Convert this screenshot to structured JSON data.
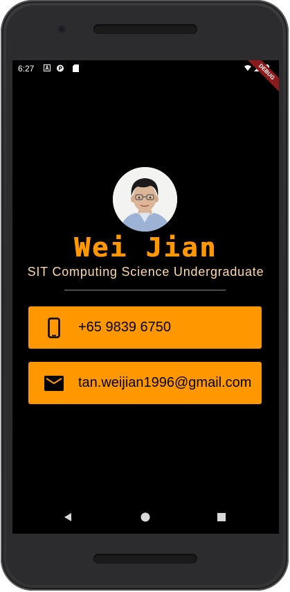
{
  "status_bar": {
    "time": "6:27",
    "icons": [
      "a-notification-icon",
      "p-notification-icon",
      "sd-card-icon",
      "wifi-icon",
      "cell-signal-icon",
      "battery-icon"
    ]
  },
  "debug_banner": "DEBUG",
  "profile": {
    "name": "Wei Jian",
    "title": "SIT Computing Science Undergraduate"
  },
  "contacts": {
    "phone": "+65 9839 6750",
    "email": "tan.weijian1996@gmail.com"
  },
  "colors": {
    "accent": "#FF9800",
    "background": "#000000",
    "subtitle": "#FFD9A6"
  },
  "nav": {
    "icons": [
      "back-icon",
      "home-icon",
      "recents-icon"
    ]
  }
}
